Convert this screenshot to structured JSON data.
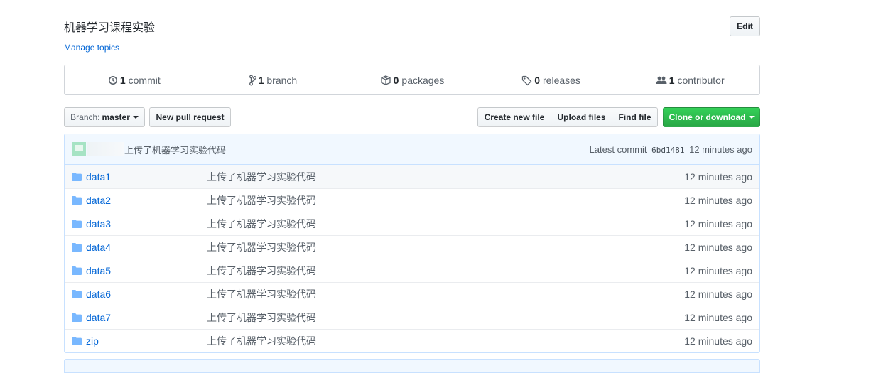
{
  "repo": {
    "description": "机器学习课程实验",
    "manage_topics": "Manage topics",
    "edit_label": "Edit"
  },
  "summary": [
    {
      "count": "1",
      "label": "commit",
      "icon": "commit-icon"
    },
    {
      "count": "1",
      "label": "branch",
      "icon": "branch-icon"
    },
    {
      "count": "0",
      "label": "packages",
      "icon": "package-icon"
    },
    {
      "count": "0",
      "label": "releases",
      "icon": "tag-icon"
    },
    {
      "count": "1",
      "label": "contributor",
      "icon": "people-icon"
    }
  ],
  "toolbar": {
    "branch_prefix": "Branch:",
    "branch_name": "master",
    "new_pull_request": "New pull request",
    "create_new_file": "Create new file",
    "upload_files": "Upload files",
    "find_file": "Find file",
    "clone_or_download": "Clone or download"
  },
  "latest_commit": {
    "message": "上传了机器学习实验代码",
    "prefix": "Latest commit",
    "sha": "6bd1481",
    "age": "12 minutes ago"
  },
  "files": [
    {
      "name": "data1",
      "message": "上传了机器学习实验代码",
      "age": "12 minutes ago"
    },
    {
      "name": "data2",
      "message": "上传了机器学习实验代码",
      "age": "12 minutes ago"
    },
    {
      "name": "data3",
      "message": "上传了机器学习实验代码",
      "age": "12 minutes ago"
    },
    {
      "name": "data4",
      "message": "上传了机器学习实验代码",
      "age": "12 minutes ago"
    },
    {
      "name": "data5",
      "message": "上传了机器学习实验代码",
      "age": "12 minutes ago"
    },
    {
      "name": "data6",
      "message": "上传了机器学习实验代码",
      "age": "12 minutes ago"
    },
    {
      "name": "data7",
      "message": "上传了机器学习实验代码",
      "age": "12 minutes ago"
    },
    {
      "name": "zip",
      "message": "上传了机器学习实验代码",
      "age": "12 minutes ago"
    }
  ],
  "colors": {
    "link": "#0366d6",
    "clone_button": "#28a745",
    "folder_icon": "#79b8ff",
    "commit_bar_bg": "#f1f8ff"
  }
}
